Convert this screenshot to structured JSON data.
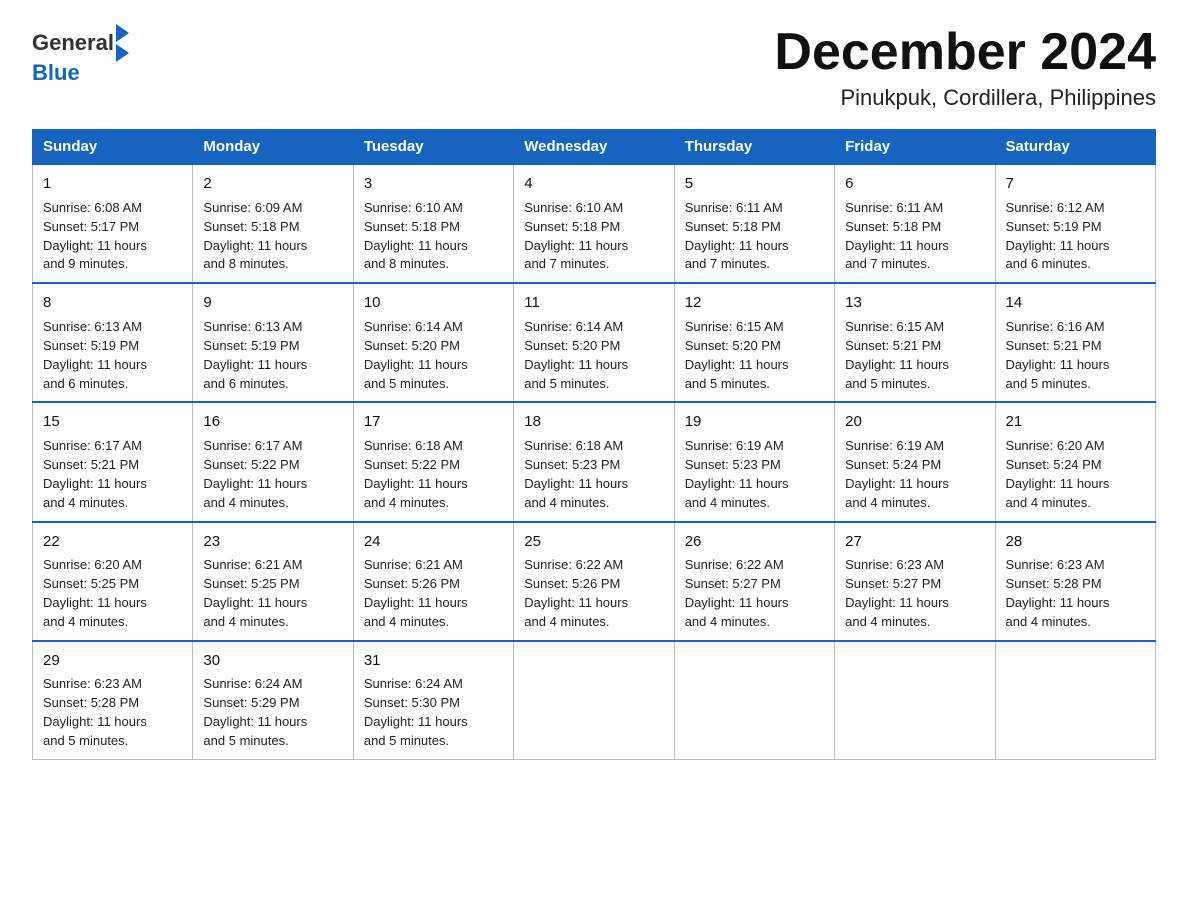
{
  "logo": {
    "text_general": "General",
    "text_blue": "Blue"
  },
  "title": "December 2024",
  "subtitle": "Pinukpuk, Cordillera, Philippines",
  "days_of_week": [
    "Sunday",
    "Monday",
    "Tuesday",
    "Wednesday",
    "Thursday",
    "Friday",
    "Saturday"
  ],
  "weeks": [
    [
      {
        "day": "1",
        "sunrise": "6:08 AM",
        "sunset": "5:17 PM",
        "daylight": "11 hours and 9 minutes."
      },
      {
        "day": "2",
        "sunrise": "6:09 AM",
        "sunset": "5:18 PM",
        "daylight": "11 hours and 8 minutes."
      },
      {
        "day": "3",
        "sunrise": "6:10 AM",
        "sunset": "5:18 PM",
        "daylight": "11 hours and 8 minutes."
      },
      {
        "day": "4",
        "sunrise": "6:10 AM",
        "sunset": "5:18 PM",
        "daylight": "11 hours and 7 minutes."
      },
      {
        "day": "5",
        "sunrise": "6:11 AM",
        "sunset": "5:18 PM",
        "daylight": "11 hours and 7 minutes."
      },
      {
        "day": "6",
        "sunrise": "6:11 AM",
        "sunset": "5:18 PM",
        "daylight": "11 hours and 7 minutes."
      },
      {
        "day": "7",
        "sunrise": "6:12 AM",
        "sunset": "5:19 PM",
        "daylight": "11 hours and 6 minutes."
      }
    ],
    [
      {
        "day": "8",
        "sunrise": "6:13 AM",
        "sunset": "5:19 PM",
        "daylight": "11 hours and 6 minutes."
      },
      {
        "day": "9",
        "sunrise": "6:13 AM",
        "sunset": "5:19 PM",
        "daylight": "11 hours and 6 minutes."
      },
      {
        "day": "10",
        "sunrise": "6:14 AM",
        "sunset": "5:20 PM",
        "daylight": "11 hours and 5 minutes."
      },
      {
        "day": "11",
        "sunrise": "6:14 AM",
        "sunset": "5:20 PM",
        "daylight": "11 hours and 5 minutes."
      },
      {
        "day": "12",
        "sunrise": "6:15 AM",
        "sunset": "5:20 PM",
        "daylight": "11 hours and 5 minutes."
      },
      {
        "day": "13",
        "sunrise": "6:15 AM",
        "sunset": "5:21 PM",
        "daylight": "11 hours and 5 minutes."
      },
      {
        "day": "14",
        "sunrise": "6:16 AM",
        "sunset": "5:21 PM",
        "daylight": "11 hours and 5 minutes."
      }
    ],
    [
      {
        "day": "15",
        "sunrise": "6:17 AM",
        "sunset": "5:21 PM",
        "daylight": "11 hours and 4 minutes."
      },
      {
        "day": "16",
        "sunrise": "6:17 AM",
        "sunset": "5:22 PM",
        "daylight": "11 hours and 4 minutes."
      },
      {
        "day": "17",
        "sunrise": "6:18 AM",
        "sunset": "5:22 PM",
        "daylight": "11 hours and 4 minutes."
      },
      {
        "day": "18",
        "sunrise": "6:18 AM",
        "sunset": "5:23 PM",
        "daylight": "11 hours and 4 minutes."
      },
      {
        "day": "19",
        "sunrise": "6:19 AM",
        "sunset": "5:23 PM",
        "daylight": "11 hours and 4 minutes."
      },
      {
        "day": "20",
        "sunrise": "6:19 AM",
        "sunset": "5:24 PM",
        "daylight": "11 hours and 4 minutes."
      },
      {
        "day": "21",
        "sunrise": "6:20 AM",
        "sunset": "5:24 PM",
        "daylight": "11 hours and 4 minutes."
      }
    ],
    [
      {
        "day": "22",
        "sunrise": "6:20 AM",
        "sunset": "5:25 PM",
        "daylight": "11 hours and 4 minutes."
      },
      {
        "day": "23",
        "sunrise": "6:21 AM",
        "sunset": "5:25 PM",
        "daylight": "11 hours and 4 minutes."
      },
      {
        "day": "24",
        "sunrise": "6:21 AM",
        "sunset": "5:26 PM",
        "daylight": "11 hours and 4 minutes."
      },
      {
        "day": "25",
        "sunrise": "6:22 AM",
        "sunset": "5:26 PM",
        "daylight": "11 hours and 4 minutes."
      },
      {
        "day": "26",
        "sunrise": "6:22 AM",
        "sunset": "5:27 PM",
        "daylight": "11 hours and 4 minutes."
      },
      {
        "day": "27",
        "sunrise": "6:23 AM",
        "sunset": "5:27 PM",
        "daylight": "11 hours and 4 minutes."
      },
      {
        "day": "28",
        "sunrise": "6:23 AM",
        "sunset": "5:28 PM",
        "daylight": "11 hours and 4 minutes."
      }
    ],
    [
      {
        "day": "29",
        "sunrise": "6:23 AM",
        "sunset": "5:28 PM",
        "daylight": "11 hours and 5 minutes."
      },
      {
        "day": "30",
        "sunrise": "6:24 AM",
        "sunset": "5:29 PM",
        "daylight": "11 hours and 5 minutes."
      },
      {
        "day": "31",
        "sunrise": "6:24 AM",
        "sunset": "5:30 PM",
        "daylight": "11 hours and 5 minutes."
      },
      null,
      null,
      null,
      null
    ]
  ]
}
